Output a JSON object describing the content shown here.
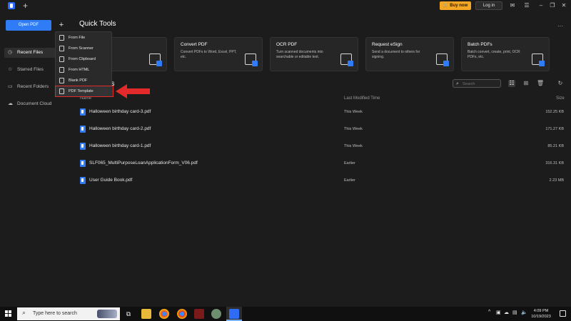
{
  "titlebar": {
    "new_tab": "+",
    "buy_label": "Buy now",
    "login_label": "Log in"
  },
  "sidebar": {
    "open_pdf": "Open PDF",
    "plus": "+",
    "items": [
      {
        "label": "Recent Files",
        "icon": "clock-icon"
      },
      {
        "label": "Starred Files",
        "icon": "star-icon"
      },
      {
        "label": "Recent Folders",
        "icon": "folder-icon"
      },
      {
        "label": "Document Cloud",
        "icon": "cloud-icon"
      }
    ]
  },
  "menu": {
    "items": [
      "From File",
      "From Scanner",
      "From Clipboard",
      "From HTML",
      "Blank PDF",
      "PDF Template"
    ]
  },
  "main": {
    "quick_tools_title": "Quick Tools",
    "cards": [
      {
        "title": "",
        "desc": "images in a file."
      },
      {
        "title": "Convert PDF",
        "desc": "Convert PDFs to Word, Excel, PPT, etc."
      },
      {
        "title": "OCR PDF",
        "desc": "Turn scanned documents into searchable or editable text."
      },
      {
        "title": "Request eSign",
        "desc": "Send a document to others for signing."
      },
      {
        "title": "Batch PDFs",
        "desc": "Batch convert, create, print, OCR PDFs, etc."
      }
    ],
    "files_title": "es",
    "search_placeholder": "Search",
    "columns": {
      "name": "Name",
      "modified": "Last Modified Time",
      "size": "Size"
    },
    "files": [
      {
        "name": "Halloween birthday card-3.pdf",
        "modified": "This Week",
        "size": "152.25 KB"
      },
      {
        "name": "Halloween birthday card-2.pdf",
        "modified": "This Week",
        "size": "171.27 KB"
      },
      {
        "name": "Halloween birthday card-1.pdf",
        "modified": "This Week",
        "size": "85.21 KB"
      },
      {
        "name": "SLF065_MultiPurposeLoanApplicationForm_V06.pdf",
        "modified": "Earlier",
        "size": "316.31 KB"
      },
      {
        "name": "User Guide Book.pdf",
        "modified": "Earlier",
        "size": "2.23 MB"
      }
    ]
  },
  "taskbar": {
    "search_text": "Type here to search",
    "time": "4:09 PM",
    "date": "10/19/2023"
  },
  "colors": {
    "accent": "#2f7cf6",
    "buy": "#f5a623",
    "highlight": "#e22a2a"
  }
}
